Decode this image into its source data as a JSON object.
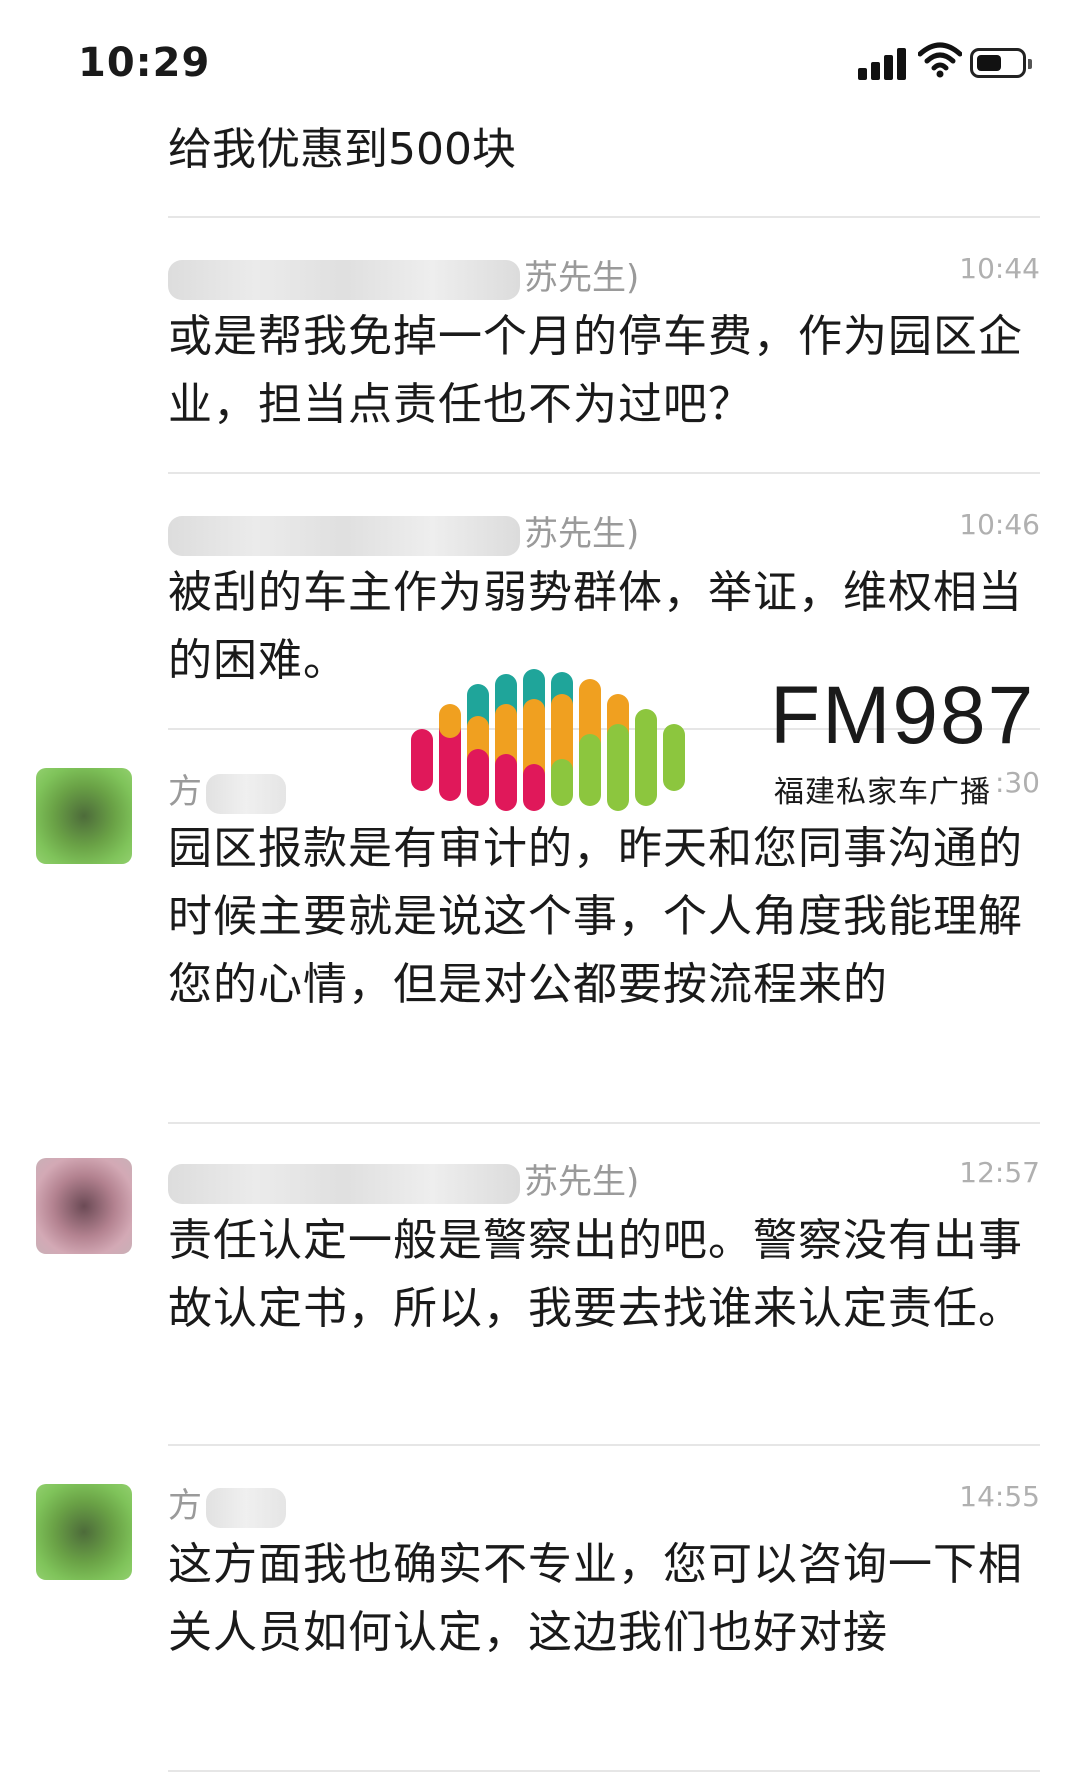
{
  "status": {
    "time": "10:29"
  },
  "first_message": "给我优惠到500块",
  "messages": [
    {
      "sender_suffix": "苏先生)",
      "time": "10:44",
      "text": "或是帮我免掉一个月的停车费，作为园区企业，担当点责任也不为过吧？"
    },
    {
      "sender_suffix": "苏先生)",
      "time": "10:46",
      "text": "被刮的车主作为弱势群体，举证，维权相当的困难。"
    },
    {
      "sender_prefix": "方",
      "time": ":30",
      "text": "园区报款是有审计的，昨天和您同事沟通的时候主要就是说这个事，个人角度我能理解您的心情，但是对公都要按流程来的"
    },
    {
      "sender_suffix": "苏先生)",
      "time": "12:57",
      "text": "责任认定一般是警察出的吧。警察没有出事故认定书，所以，我要去找谁来认定责任。"
    },
    {
      "sender_prefix": "方",
      "time": "14:55",
      "text": "这方面我也确实不专业，您可以咨询一下相关人员如何认定，这边我们也好对接"
    }
  ],
  "watermark": {
    "title": "FM987",
    "subtitle": "福建私家车广播"
  },
  "colors": {
    "teal": "#1fa59a",
    "orange": "#f0a020",
    "pink": "#e0185a",
    "green": "#8cc63e"
  },
  "icons": [
    "signal-icon",
    "wifi-icon",
    "battery-icon"
  ]
}
